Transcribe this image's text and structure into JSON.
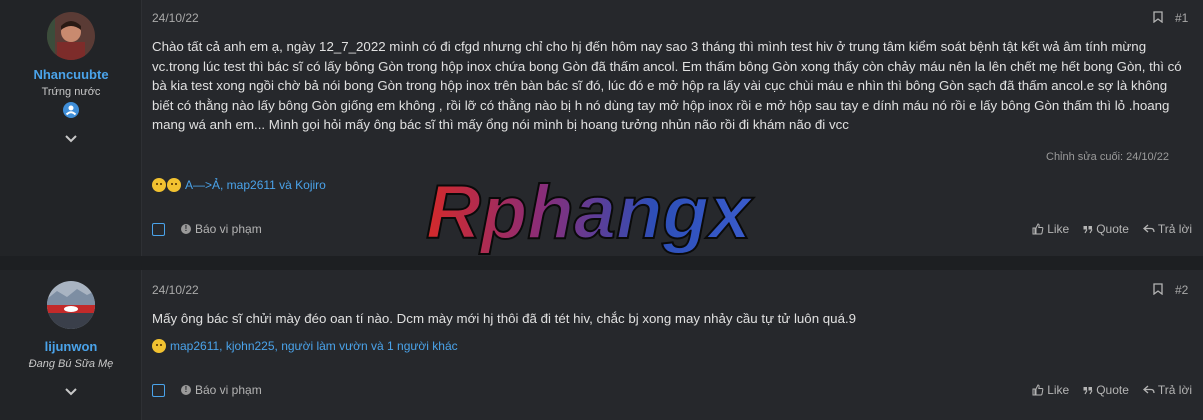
{
  "posts": [
    {
      "username": "Nhancuubte",
      "user_title": "Trứng nước",
      "date": "24/10/22",
      "post_number": "#1",
      "body": "Chào tất cả anh em ạ, ngày 12_7_2022 mình có đi cfgd nhưng chỉ cho hj đến hôm nay sao 3 tháng thì mình test hiv ở trung tâm kiểm soát bệnh tật kết wả âm tính mừng vc.trong lúc test thì bác sĩ có lấy bông Gòn trong hộp inox chứa bong Gòn đã thấm ancol. Em thấm bông Gòn xong thấy còn chảy máu nên la lên chết mẹ hết bong Gòn, thì có bà kia test xong ngồi chờ bả nói bong Gòn trong hộp inox trên bàn bác sĩ đó, lúc đó e mở hộp ra lấy vài cục chùi máu e nhìn thì bông Gòn sạch đã thấm ancol.e sợ là không biết có thằng nào lấy bông Gòn giống em không , rồi lỡ có thằng nào bị h nó dùng tay mở hộp inox rồi e mở hộp sau tay e dính máu nó rồi e lấy bông Gòn thấm thì lỏ .hoang mang wá anh em... Mình gọi hỏi mấy ông bác sĩ thì mấy ổng nói mình bị hoang tưởng nhủn não rồi đi khám não đi vcc",
      "edited": "Chỉnh sửa cuối: 24/10/22",
      "reactions": "A—>Ả, map2611 và Kojiro",
      "report": "Báo vi phạm",
      "like": "Like",
      "quote": "Quote",
      "reply": "Trả lời"
    },
    {
      "username": "lijunwon",
      "user_title": "Đang Bú Sữa Mẹ",
      "date": "24/10/22",
      "post_number": "#2",
      "body": "Mấy ông bác sĩ chửi mày đéo oan tí nào. Dcm mày mới hj thôi đã đi tét hiv, chắc bj xong may nhảy cầu tự tử luôn quá.9",
      "reactions": "map2611, kjohn225, người làm vườn và 1 người khác",
      "report": "Báo vi phạm",
      "like": "Like",
      "quote": "Quote",
      "reply": "Trả lời"
    }
  ],
  "watermark": "Rphangx",
  "colors": {
    "accent": "#4aa3ea",
    "background": "#1d1f22",
    "post_bg": "#26282c"
  }
}
